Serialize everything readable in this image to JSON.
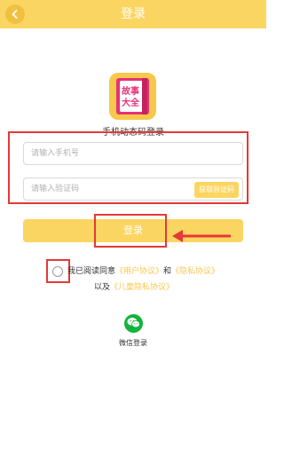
{
  "header": {
    "title": "登录"
  },
  "logo": {
    "line1": "故事",
    "line2": "大全"
  },
  "login_mode": "手机动态码登录",
  "phone": {
    "placeholder": "请输入手机号"
  },
  "code": {
    "placeholder": "请输入验证码",
    "button": "获取验证码"
  },
  "login_button": "登录",
  "agreement": {
    "prefix": "我已阅读同意",
    "user_agreement": "《用户协议》",
    "and": "和",
    "privacy_policy": "《隐私协议》",
    "and2": "以及",
    "child_privacy": "《儿童隐私协议》"
  },
  "wechat_login": "微信登录",
  "colors": {
    "accent": "#fbd562",
    "highlight": "#e53935",
    "wechat": "#12b43c"
  }
}
